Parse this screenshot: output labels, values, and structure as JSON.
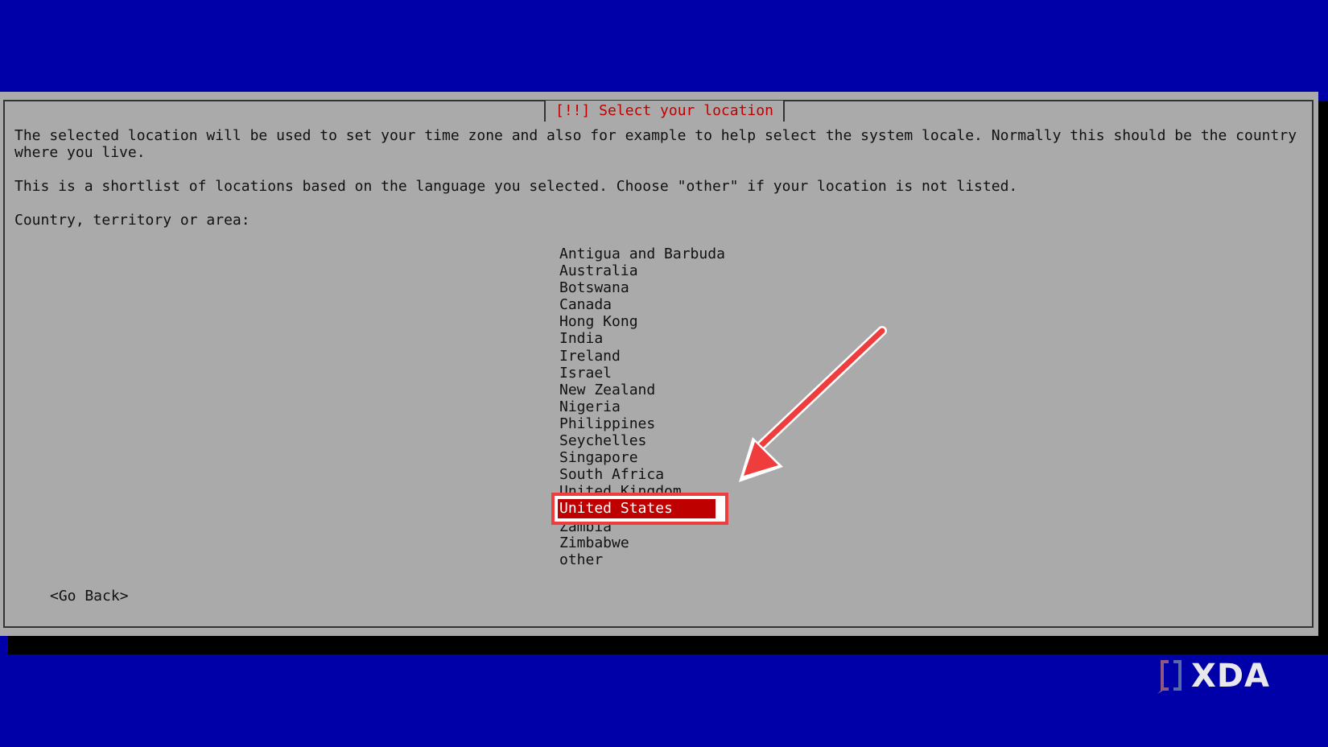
{
  "dialog": {
    "title": "[!!] Select your location",
    "paragraph_1": "The selected location will be used to set your time zone and also for example to help select the system locale. Normally this should be the country where you live.",
    "paragraph_2": "This is a shortlist of locations based on the language you selected. Choose \"other\" if your location is not listed.",
    "prompt_label": "Country, territory or area:",
    "go_back_label": "<Go Back>"
  },
  "countries": {
    "items": [
      "Antigua and Barbuda",
      "Australia",
      "Botswana",
      "Canada",
      "Hong Kong",
      "India",
      "Ireland",
      "Israel",
      "New Zealand",
      "Nigeria",
      "Philippines",
      "Seychelles",
      "Singapore",
      "South Africa",
      "United Kingdom",
      "United States",
      "Zambia",
      "Zimbabwe",
      "other"
    ],
    "selected": "United States"
  },
  "branding": {
    "logo_text": "XDA"
  },
  "colors": {
    "background": "#0000a8",
    "dialog": "#aaaaaa",
    "title": "#c00000",
    "selection": "#bf0000",
    "annotation": "#ef3c3c"
  },
  "icons": {
    "arrow": "red-arrow-icon",
    "logo": "xda-logo-icon"
  }
}
